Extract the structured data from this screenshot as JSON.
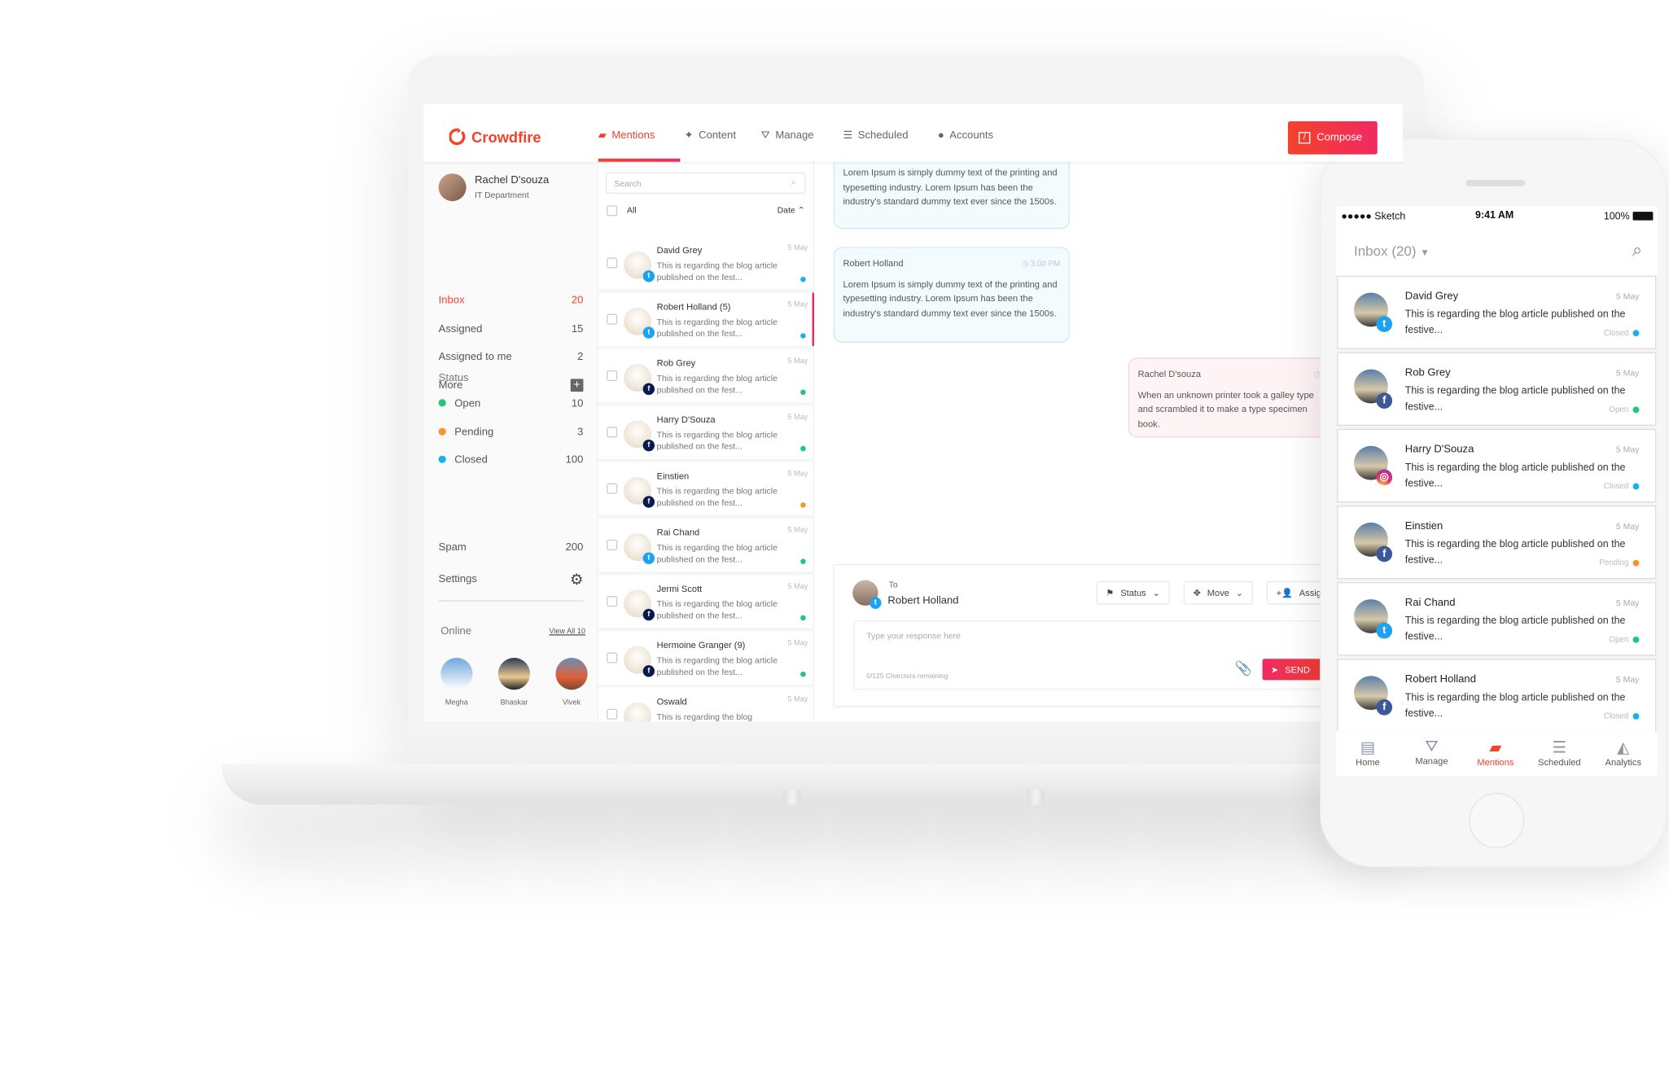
{
  "app": {
    "brand": "Crowdfire",
    "compose_label": "Compose",
    "accent": "#f4412b"
  },
  "nav": [
    {
      "label": "Mentions",
      "icon": "chat-icon",
      "active": true
    },
    {
      "label": "Content",
      "icon": "sparkle-icon"
    },
    {
      "label": "Manage",
      "icon": "network-icon"
    },
    {
      "label": "Scheduled",
      "icon": "list-icon"
    },
    {
      "label": "Accounts",
      "icon": "user-icon"
    }
  ],
  "profile": {
    "name": "Rachel D'souza",
    "department": "IT Department"
  },
  "sidebar": {
    "folders": [
      {
        "label": "Inbox",
        "count": "20",
        "active": true
      },
      {
        "label": "Assigned",
        "count": "15"
      },
      {
        "label": "Assigned to me",
        "count": "2"
      },
      {
        "label": "More",
        "count": ""
      }
    ],
    "status_title": "Status",
    "statuses": [
      {
        "label": "Open",
        "count": "10",
        "color": "#1ec77a"
      },
      {
        "label": "Pending",
        "count": "3",
        "color": "#f7932d"
      },
      {
        "label": "Closed",
        "count": "100",
        "color": "#1ab0ef"
      }
    ],
    "spam": {
      "label": "Spam",
      "count": "200"
    },
    "settings_label": "Settings",
    "online_title": "Online",
    "view_all": "View All 10",
    "online": [
      {
        "name": "Megha"
      },
      {
        "name": "Bhaskar"
      },
      {
        "name": "Vivek"
      }
    ]
  },
  "list": {
    "search_placeholder": "Search",
    "all_label": "All",
    "sort_label": "Date",
    "items": [
      {
        "name": "David Grey",
        "date": "5 May",
        "text": "This is regarding the blog article published on the fest...",
        "platform": "twitter",
        "status": "#1ab0ef"
      },
      {
        "name": "Robert Holland (5)",
        "date": "5 May",
        "text": "This is regarding the blog article published on the fest...",
        "platform": "twitter",
        "status": "#1ab0ef",
        "selected": true
      },
      {
        "name": "Rob Grey",
        "date": "5 May",
        "text": "This is regarding the blog article published on the fest...",
        "platform": "facebook",
        "status": "#1ec77a"
      },
      {
        "name": "Harry D'Souza",
        "date": "5 May",
        "text": "This is regarding the blog article published on the fest...",
        "platform": "facebook",
        "status": "#1ec77a"
      },
      {
        "name": "Einstien",
        "date": "5 May",
        "text": "This is regarding the blog article published on the fest...",
        "platform": "facebook",
        "status": "#f7932d"
      },
      {
        "name": "Rai Chand",
        "date": "5 May",
        "text": "This is regarding the blog article published on the fest...",
        "platform": "twitter",
        "status": "#1ec77a"
      },
      {
        "name": "Jermi Scott",
        "date": "5 May",
        "text": "This is regarding the blog article published on the fest...",
        "platform": "facebook",
        "status": "#1ec77a"
      },
      {
        "name": "Hermoine Granger (9)",
        "date": "5 May",
        "text": "This is regarding the blog article published on the fest...",
        "platform": "facebook",
        "status": "#1ec77a"
      },
      {
        "name": "Oswald",
        "date": "5 May",
        "text": "This is regarding the blog",
        "platform": "facebook",
        "status": "#1ec77a"
      }
    ]
  },
  "conversation": [
    {
      "name": "",
      "time": "",
      "text": "Lorem Ipsum is simply dummy text of the printing and typesetting industry. Lorem Ipsum has been the industry's standard dummy text ever since the 1500s."
    },
    {
      "name": "Robert Holland",
      "time": "3:00 PM",
      "text": "Lorem Ipsum is simply dummy text of the printing and typesetting industry. Lorem Ipsum has been the industry's standard dummy text ever since the 1500s."
    },
    {
      "name": "Rachel D'souza",
      "time": "",
      "text": "When an unknown printer took a galley type and scrambled it to make a type specimen book."
    }
  ],
  "reply": {
    "to_label": "To",
    "to_name": "Robert Holland",
    "status_label": "Status",
    "move_label": "Move",
    "assign_label": "Assign",
    "placeholder": "Type your response here",
    "counter": "0/125 Charcters remaining",
    "send_label": "SEND"
  },
  "phone": {
    "carrier": "●●●●● Sketch",
    "time": "9:41 AM",
    "battery": "100%",
    "inbox_title": "Inbox (20)",
    "cards": [
      {
        "name": "David Grey",
        "date": "5 May",
        "text": "This is regarding the blog article published on the festive...",
        "platform": "twitter",
        "status": "Closed",
        "color": "#1ab0ef"
      },
      {
        "name": "Rob Grey",
        "date": "5 May",
        "text": "This is regarding the blog article published on the festive...",
        "platform": "facebook",
        "status": "Open",
        "color": "#1ec77a"
      },
      {
        "name": "Harry D'Souza",
        "date": "5 May",
        "text": "This is regarding the blog article published on the festive...",
        "platform": "instagram",
        "status": "Closed",
        "color": "#1ab0ef"
      },
      {
        "name": "Einstien",
        "date": "5 May",
        "text": "This is regarding the blog article published on the festive...",
        "platform": "facebook",
        "status": "Pending",
        "color": "#f7932d"
      },
      {
        "name": "Rai Chand",
        "date": "5 May",
        "text": "This is regarding the blog article published on the festive...",
        "platform": "twitter",
        "status": "Open",
        "color": "#1ec77a"
      },
      {
        "name": "Robert Holland",
        "date": "5 May",
        "text": "This is regarding the blog article published on the festive...",
        "platform": "facebook",
        "status": "Closed",
        "color": "#1ab0ef"
      }
    ],
    "tabs": [
      {
        "label": "Home",
        "icon": "home-icon"
      },
      {
        "label": "Manage",
        "icon": "manage-icon"
      },
      {
        "label": "Mentions",
        "icon": "mentions-icon",
        "active": true
      },
      {
        "label": "Scheduled",
        "icon": "scheduled-icon"
      },
      {
        "label": "Analytics",
        "icon": "analytics-icon"
      }
    ]
  }
}
